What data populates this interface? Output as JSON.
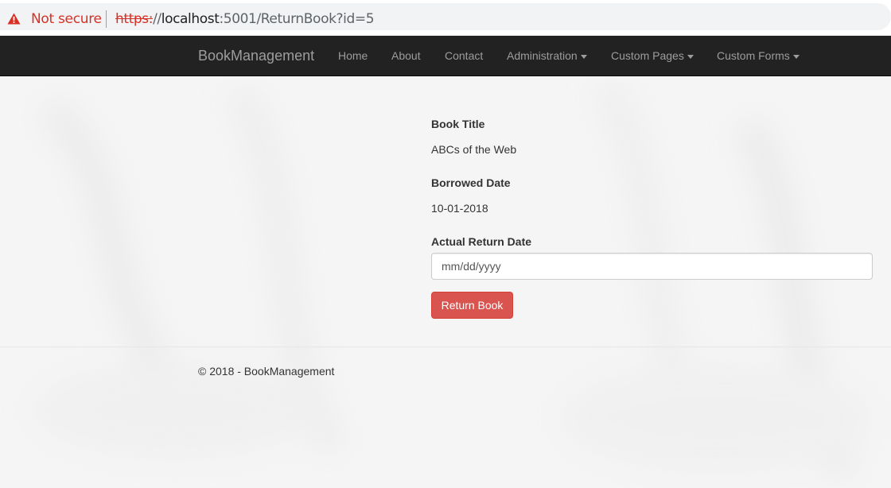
{
  "browser": {
    "security_label": "Not secure",
    "url_scheme": "https:",
    "url_slashes": "//",
    "url_host": "localhost",
    "url_rest": ":5001/ReturnBook?id=5",
    "warning_color": "#d93025",
    "icon": "warning-triangle-icon"
  },
  "navbar": {
    "brand": "BookManagement",
    "items": [
      {
        "label": "Home"
      },
      {
        "label": "About"
      },
      {
        "label": "Contact"
      },
      {
        "label": "Administration",
        "dropdown": true
      },
      {
        "label": "Custom Pages",
        "dropdown": true
      },
      {
        "label": "Custom Forms",
        "dropdown": true
      }
    ]
  },
  "form": {
    "book_title_label": "Book Title",
    "book_title_value": "ABCs of the Web",
    "borrowed_date_label": "Borrowed Date",
    "borrowed_date_value": "10-01-2018",
    "return_date_label": "Actual Return Date",
    "return_date_placeholder": "mm/dd/yyyy",
    "return_date_value": "",
    "submit_label": "Return Book",
    "submit_color": "#d9534f"
  },
  "footer": {
    "text": "© 2018 - BookManagement"
  }
}
